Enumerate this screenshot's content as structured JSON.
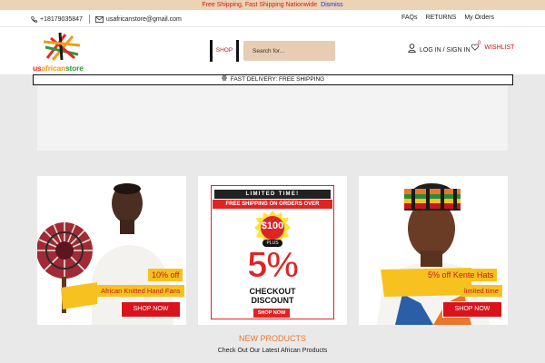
{
  "notice": {
    "text": "Free Shipping, Fast Shipping Nationwide",
    "dismiss": "Dismiss"
  },
  "topbar": {
    "phone": "+18179035847",
    "email": "usafricanstore@gmail.com",
    "links": [
      "FAQs",
      "RETURNS",
      "My Orders"
    ]
  },
  "header": {
    "logo": {
      "part1": "us",
      "part2": "african",
      "part3": "store"
    },
    "shop_label": "SHOP",
    "search_placeholder": "Search for...",
    "account_label": "LOG IN / SIGN IN",
    "wishlist_label": "WISHLIST",
    "wishlist_count": "0"
  },
  "delivery_bar": {
    "text": "FAST DELIVERY: FREE SHIPPING"
  },
  "promos": [
    {
      "title": "10% off",
      "subtitle": "African Knitted Hand Fans",
      "button": "SHOP NOW"
    },
    {
      "badge": "LIMITED TIME!",
      "headline": "FREE SHIPPING ON ORDERS OVER",
      "amount": "$100",
      "plus": "PLUS",
      "percent": "5%",
      "line1": "CHECKOUT",
      "line2": "DISCOUNT",
      "button": "SHOP NOW"
    },
    {
      "title": "5% off Kente Hats",
      "subtitle": "limited time",
      "button": "SHOP NOW"
    }
  ],
  "section": {
    "title": "NEW PRODUCTS",
    "subtitle": "Check Out Our Latest African Products"
  },
  "colors": {
    "accent_red": "#d9131c",
    "promo_yellow": "#f7c21f",
    "beige": "#e6cdb3",
    "orange_title": "#e8772e"
  }
}
